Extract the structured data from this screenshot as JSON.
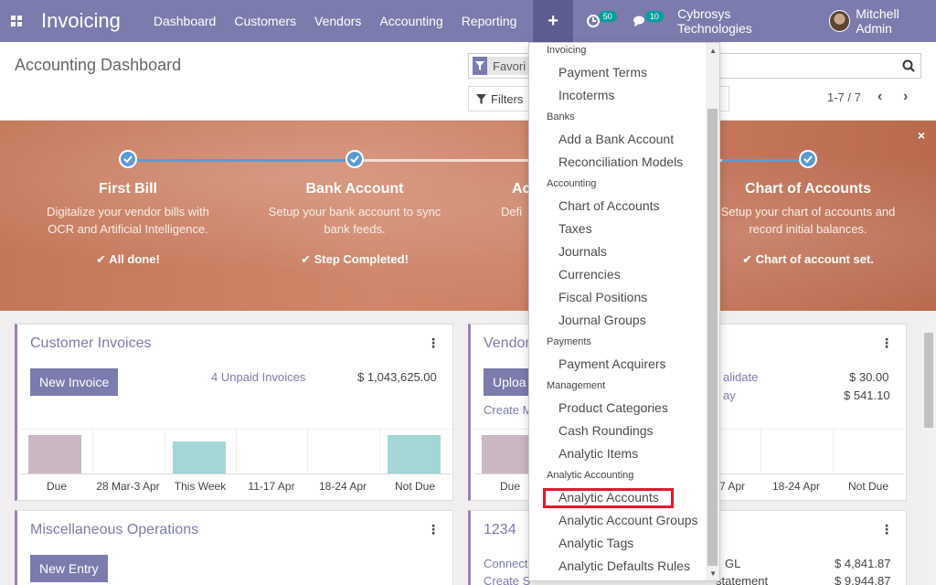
{
  "topbar": {
    "app_name": "Invoicing",
    "menu": [
      "Dashboard",
      "Customers",
      "Vendors",
      "Accounting",
      "Reporting"
    ],
    "plus": "+",
    "activity_count": "50",
    "messages_count": "10",
    "company": "Cybrosys Technologies",
    "user": "Mitchell Admin"
  },
  "control": {
    "title": "Accounting Dashboard",
    "facet": "Favori",
    "filters": "Filters",
    "pager": "1-7 / 7"
  },
  "banner": {
    "close": "×",
    "steps": [
      {
        "title": "First Bill",
        "desc1": "Digitalize your vendor bills with",
        "desc2": "OCR and Artificial Intelligence.",
        "done": "All done!"
      },
      {
        "title": "Bank Account",
        "desc1": "Setup your bank account to sync",
        "desc2": "bank feeds.",
        "done": "Step Completed!"
      },
      {
        "title": "Ac",
        "desc1": "Defi",
        "desc2": "",
        "done": ""
      },
      {
        "title": "Chart of Accounts",
        "desc1": "Setup your chart of accounts and",
        "desc2": "record initial balances.",
        "done": "Chart of account set."
      }
    ]
  },
  "cards": {
    "customer_invoices": {
      "title": "Customer Invoices",
      "button": "New Invoice",
      "link": "4 Unpaid Invoices",
      "amount": "$ 1,043,625.00",
      "labels": [
        "Due",
        "28 Mar-3 Apr",
        "This Week",
        "11-17 Apr",
        "18-24 Apr",
        "Not Due"
      ]
    },
    "vendor_bills": {
      "title": "Vendor",
      "button": "Uploa",
      "link": "Create M",
      "link_validate": "alidate",
      "link_pay": "ay",
      "amount1": "$ 30.00",
      "amount2": "$ 541.10",
      "labels": [
        "Due",
        "7 Apr",
        "18-24 Apr",
        "Not Due"
      ]
    },
    "misc": {
      "title": "Miscellaneous Operations",
      "button": "New Entry"
    },
    "bank": {
      "title": "1234",
      "link1": "Connect",
      "link2": "Create S",
      "tail1": "GL",
      "tail2": "statement",
      "amount1": "$ 4,841.87",
      "amount2": "$ 9,944.87"
    }
  },
  "dropdown": {
    "sections": {
      "invoicing": "Invoicing",
      "banks": "Banks",
      "accounting": "Accounting",
      "payments": "Payments",
      "management": "Management",
      "analytic": "Analytic Accounting"
    },
    "invoicing_items": [
      "Payment Terms",
      "Incoterms"
    ],
    "banks_items": [
      "Add a Bank Account",
      "Reconciliation Models"
    ],
    "accounting_items": [
      "Chart of Accounts",
      "Taxes",
      "Journals",
      "Currencies",
      "Fiscal Positions",
      "Journal Groups"
    ],
    "payments_items": [
      "Payment Acquirers"
    ],
    "management_items": [
      "Product Categories",
      "Cash Roundings",
      "Analytic Items"
    ],
    "analytic_items": [
      "Analytic Accounts",
      "Analytic Account Groups",
      "Analytic Tags",
      "Analytic Defaults Rules"
    ]
  }
}
